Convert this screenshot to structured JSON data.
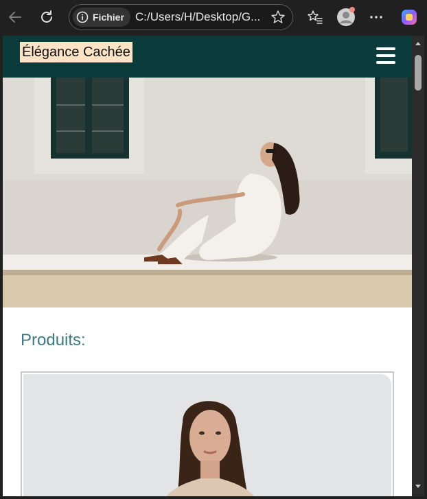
{
  "browser": {
    "site_chip_label": "Fichier",
    "address": "C:/Users/H/Desktop/G...",
    "colors": {
      "toolbar_bg": "#202020",
      "address_border": "#5a5a5a"
    }
  },
  "header": {
    "brand": "Élégance Cachée",
    "colors": {
      "bg": "#0b3b3b",
      "brand_highlight": "#fde3c6"
    }
  },
  "hero": {
    "image": "woman-sitting-against-white-wall-photo"
  },
  "products": {
    "title": "Produits:",
    "title_color": "#3a7a80",
    "first_card_image": "woman-portrait-photo"
  },
  "icons": [
    "back-arrow-icon",
    "refresh-icon",
    "info-icon",
    "favorite-star-icon",
    "favorites-list-icon",
    "profile-avatar-icon",
    "more-menu-icon",
    "copilot-icon",
    "hamburger-menu-icon"
  ]
}
